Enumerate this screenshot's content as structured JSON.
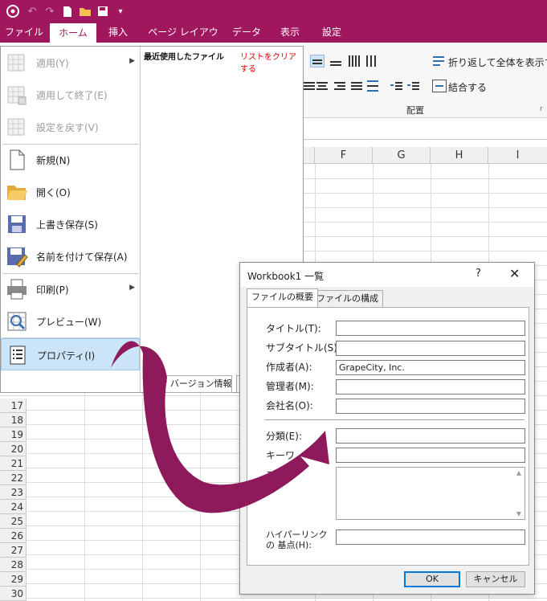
{
  "tabs": [
    "ファイル",
    "ホーム",
    "挿入",
    "ページ レイアウト",
    "データ",
    "表示",
    "設定"
  ],
  "active_tab": "ホーム",
  "ribbon": {
    "wrap_text": "折り返して全体を表示する",
    "merge": "結合する",
    "group_label": "配置",
    "more": "r"
  },
  "columns": [
    "F",
    "G",
    "H",
    "I"
  ],
  "rows": [
    "17",
    "18",
    "19",
    "20",
    "21",
    "22",
    "23",
    "24",
    "25",
    "26",
    "27",
    "28",
    "29",
    "30"
  ],
  "file_menu": {
    "items": [
      {
        "label": "適用(Y)",
        "icon": "table-apply-icon",
        "disabled": true,
        "arrow": true
      },
      {
        "label": "適用して終了(E)",
        "icon": "table-apply-close-icon",
        "disabled": true,
        "arrow": false
      },
      {
        "label": "設定を戻す(V)",
        "icon": "table-revert-icon",
        "disabled": true,
        "arrow": false
      },
      {
        "label": "新規(N)",
        "icon": "new-document-icon",
        "disabled": false,
        "arrow": false
      },
      {
        "label": "開く(O)",
        "icon": "folder-open-icon",
        "disabled": false,
        "arrow": false
      },
      {
        "label": "上書き保存(S)",
        "icon": "save-icon",
        "disabled": false,
        "arrow": false
      },
      {
        "label": "名前を付けて保存(A)",
        "icon": "save-as-icon",
        "disabled": false,
        "arrow": false
      },
      {
        "label": "印刷(P)",
        "icon": "printer-icon",
        "disabled": false,
        "arrow": true
      },
      {
        "label": "プレビュー(W)",
        "icon": "preview-icon",
        "disabled": false,
        "arrow": false
      },
      {
        "label": "プロパティ(I)",
        "icon": "properties-icon",
        "disabled": false,
        "arrow": false,
        "selected": true
      }
    ],
    "recent_header": "最近使用したファイル",
    "clear_list": "リストをクリアする",
    "version_button": "バージョン情報"
  },
  "dialog": {
    "title": "Workbook1 一覧",
    "help": "?",
    "close": "✕",
    "tabs": [
      "ファイルの概要",
      "ファイルの構成"
    ],
    "fields": [
      {
        "label": "タイトル(T):",
        "value": ""
      },
      {
        "label": "サブタイトル(S):",
        "value": ""
      },
      {
        "label": "作成者(A):",
        "value": "GrapeCity, Inc."
      },
      {
        "label": "管理者(M):",
        "value": ""
      },
      {
        "label": "会社名(O):",
        "value": ""
      },
      {
        "label": "分類(E):",
        "value": ""
      },
      {
        "label": "キーワ",
        "value": ""
      },
      {
        "label": "コ",
        "value": ""
      },
      {
        "label": "ハイパーリンクの 基点(H):",
        "value": ""
      }
    ],
    "ok": "OK",
    "cancel": "キャンセル"
  },
  "colors": {
    "accent": "#a0175e",
    "arrow": "#8e1a5b",
    "selection": "#cce4f7"
  }
}
